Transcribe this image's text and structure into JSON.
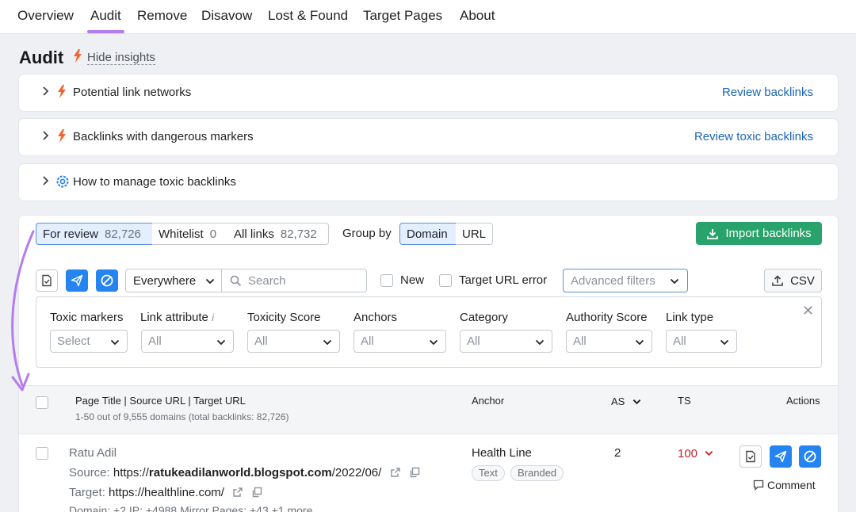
{
  "nav": {
    "tabs": [
      {
        "label": "Overview"
      },
      {
        "label": "Audit"
      },
      {
        "label": "Remove"
      },
      {
        "label": "Disavow"
      },
      {
        "label": "Lost & Found"
      },
      {
        "label": "Target Pages"
      },
      {
        "label": "About"
      }
    ],
    "active": "Audit"
  },
  "header": {
    "title": "Audit",
    "hide_insights": "Hide insights"
  },
  "insights": [
    {
      "label": "Potential link networks",
      "link": "Review backlinks",
      "icon": "bolt-icon"
    },
    {
      "label": "Backlinks with dangerous markers",
      "link": "Review toxic backlinks",
      "icon": "bolt-icon"
    },
    {
      "label": "How to manage toxic backlinks",
      "link": "",
      "icon": "gear-icon"
    }
  ],
  "segments": [
    {
      "label": "For review",
      "count": "82,726"
    },
    {
      "label": "Whitelist",
      "count": "0"
    },
    {
      "label": "All links",
      "count": "82,732"
    }
  ],
  "group_by": {
    "label": "Group by",
    "options": [
      "Domain",
      "URL"
    ],
    "selected": "Domain"
  },
  "import_button": "Import backlinks",
  "toolbar": {
    "scope": "Everywhere",
    "search_placeholder": "Search",
    "new_label": "New",
    "target_error_label": "Target URL error",
    "advanced_filters": "Advanced filters",
    "csv_label": "CSV"
  },
  "filters": [
    {
      "label": "Toxic markers",
      "value": "Select"
    },
    {
      "label": "Link attribute",
      "value": "All"
    },
    {
      "label": "Toxicity Score",
      "value": "All"
    },
    {
      "label": "Anchors",
      "value": "All"
    },
    {
      "label": "Category",
      "value": "All"
    },
    {
      "label": "Authority Score",
      "value": "All"
    },
    {
      "label": "Link type",
      "value": "All"
    }
  ],
  "table": {
    "col_main": "Page Title | Source URL | Target URL",
    "summary": "1-50 out of 9,555 domains (total backlinks: 82,726)",
    "col_anchor": "Anchor",
    "col_as": "AS",
    "col_ts": "TS",
    "col_actions": "Actions",
    "rows": [
      {
        "title": "Ratu Adil",
        "source_label": "Source:",
        "source_prefix": "https://",
        "source_domain": "ratukeadilanworld.blogspot.com",
        "source_path": "/2022/06/",
        "target_label": "Target:",
        "target_url": "https://healthline.com/",
        "meta": "Domain: +2    IP: +4988    Mirror Pages: +43    +1 more",
        "anchor": "Health Line",
        "tags": [
          "Text",
          "Branded"
        ],
        "as": "2",
        "ts": "100",
        "comment": "Comment"
      }
    ]
  },
  "colors": {
    "accent": "#b57cf0",
    "link": "#1a65b7",
    "primary_green": "#27a36b",
    "blue_action": "#2684f0",
    "toxic_red": "#c0242b"
  }
}
